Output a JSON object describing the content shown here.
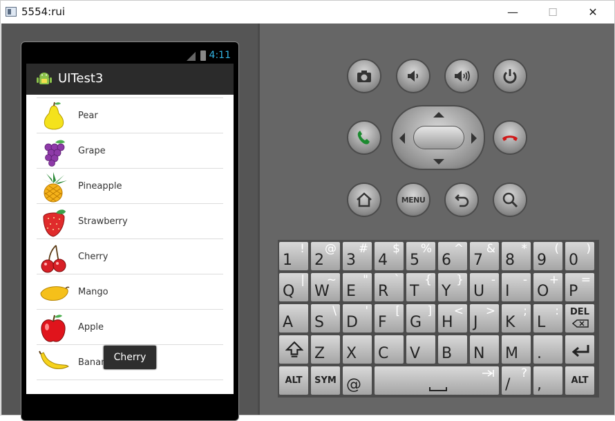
{
  "window": {
    "title": "5554:rui",
    "minimize": "—",
    "maximize": "☐",
    "close": "✕"
  },
  "device": {
    "status_time": "4:11",
    "app_title": "UITest3",
    "list": [
      {
        "label": "Pear",
        "icon": "pear-icon"
      },
      {
        "label": "Grape",
        "icon": "grape-icon"
      },
      {
        "label": "Pineapple",
        "icon": "pineapple-icon"
      },
      {
        "label": "Strawberry",
        "icon": "strawberry-icon"
      },
      {
        "label": "Cherry",
        "icon": "cherry-icon"
      },
      {
        "label": "Mango",
        "icon": "mango-icon"
      },
      {
        "label": "Apple",
        "icon": "apple-icon"
      },
      {
        "label": "Banana",
        "icon": "banana-icon"
      }
    ],
    "toast": "Cherry"
  },
  "controls": {
    "menu_label": "MENU"
  },
  "keyboard": {
    "row1": [
      [
        "1",
        "!"
      ],
      [
        "2",
        "@"
      ],
      [
        "3",
        "#"
      ],
      [
        "4",
        "$"
      ],
      [
        "5",
        "%"
      ],
      [
        "6",
        "^"
      ],
      [
        "7",
        "&"
      ],
      [
        "8",
        "*"
      ],
      [
        "9",
        "("
      ],
      [
        "0",
        ")"
      ]
    ],
    "row2": [
      [
        "Q",
        "|"
      ],
      [
        "W",
        "~"
      ],
      [
        "E",
        "\""
      ],
      [
        "R",
        "`"
      ],
      [
        "T",
        "{"
      ],
      [
        "Y",
        "}"
      ],
      [
        "U",
        "-"
      ],
      [
        "I",
        "-"
      ],
      [
        "O",
        "+"
      ],
      [
        "P",
        "="
      ]
    ],
    "row3": [
      [
        "A",
        ""
      ],
      [
        "S",
        "\\"
      ],
      [
        "D",
        "'"
      ],
      [
        "F",
        "["
      ],
      [
        "G",
        "]"
      ],
      [
        "H",
        "<"
      ],
      [
        "J",
        ">"
      ],
      [
        "K",
        ";"
      ],
      [
        "L",
        ":"
      ]
    ],
    "row3_last": "DEL",
    "row4": [
      [
        "Z",
        ""
      ],
      [
        "X",
        ""
      ],
      [
        "C",
        ""
      ],
      [
        "V",
        ""
      ],
      [
        "B",
        ""
      ],
      [
        "N",
        ""
      ],
      [
        "M",
        ""
      ],
      [
        ".",
        ""
      ]
    ],
    "row5_alt_left": "ALT",
    "row5_sym": "SYM",
    "row5_at": "@",
    "row5_slash": [
      "/",
      "?"
    ],
    "row5_comma": ",",
    "row5_alt_right": "ALT"
  },
  "colors": {
    "time": "#33b5e5",
    "actionbar": "#2b2b2b",
    "emulator_bg": "#666666"
  }
}
